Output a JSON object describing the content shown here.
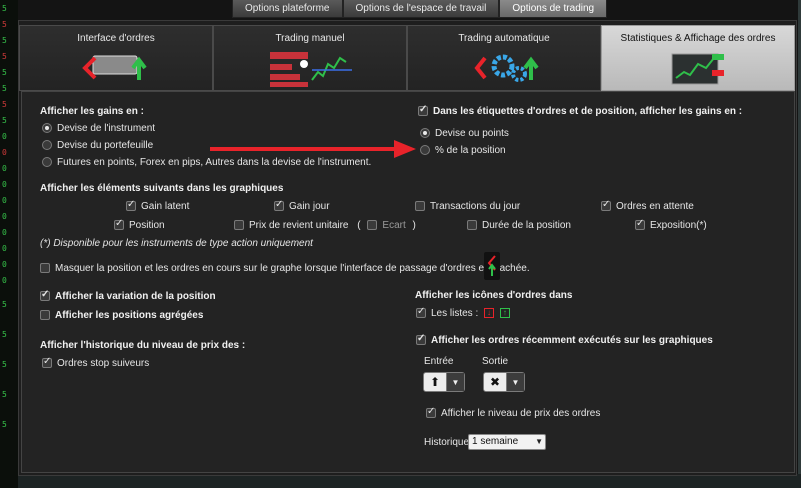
{
  "top_tabs": [
    "Options plateforme",
    "Options de l'espace de travail",
    "Options de trading"
  ],
  "sub_tabs": [
    "Interface d'ordres",
    "Trading manuel",
    "Trading automatique",
    "Statistiques & Affichage des ordres"
  ],
  "gains": {
    "title": "Afficher les gains en :",
    "options": [
      "Devise de l'instrument",
      "Devise du portefeuille",
      "Futures en points, Forex en pips, Autres dans la devise de l'instrument."
    ]
  },
  "labels_section": {
    "title": "Dans les étiquettes d'ordres et de position, afficher les gains en :",
    "options": [
      "Devise ou points",
      "% de la position"
    ]
  },
  "elements": {
    "title": "Afficher les éléments suivants dans les graphiques",
    "gain_latent": "Gain latent",
    "gain_jour": "Gain jour",
    "transactions": "Transactions du jour",
    "ordres_attente": "Ordres en attente",
    "position": "Position",
    "prix_revient": "Prix de revient unitaire",
    "paren_open": "(",
    "ecart": "Ecart",
    "paren_close": ")",
    "duree": "Durée de la position",
    "exposition": "Exposition(*)",
    "note": "(*) Disponible pour les instruments de type action uniquement"
  },
  "masquer": "Masquer la position et les ordres en cours sur le graphe lorsque l'interface de passage d'ordres est cachée.",
  "variation": "Afficher la variation de la position",
  "agregees": "Afficher les positions agrégées",
  "historique_title": "Afficher l'historique du niveau de prix des :",
  "stop_suiveurs": "Ordres stop suiveurs",
  "icones": {
    "title": "Afficher les icônes d'ordres dans",
    "listes": "Les listes :"
  },
  "recents": {
    "title": "Afficher les ordres récemment exécutés sur les graphiques",
    "entree": "Entrée",
    "sortie": "Sortie",
    "niveau": "Afficher le niveau de prix des ordres",
    "historique_label": "Historique",
    "historique_value": "1 semaine"
  },
  "left_numbers": [
    "5",
    "5",
    "5",
    "5",
    "5",
    "5",
    "5",
    "5",
    "0",
    "0",
    "0",
    "0",
    "0",
    "0",
    "0",
    "0",
    "0",
    "0",
    "5",
    "5",
    "5",
    "5",
    "5"
  ],
  "colors": {
    "accent_red": "#e8232a",
    "green": "#2fbf4a"
  }
}
